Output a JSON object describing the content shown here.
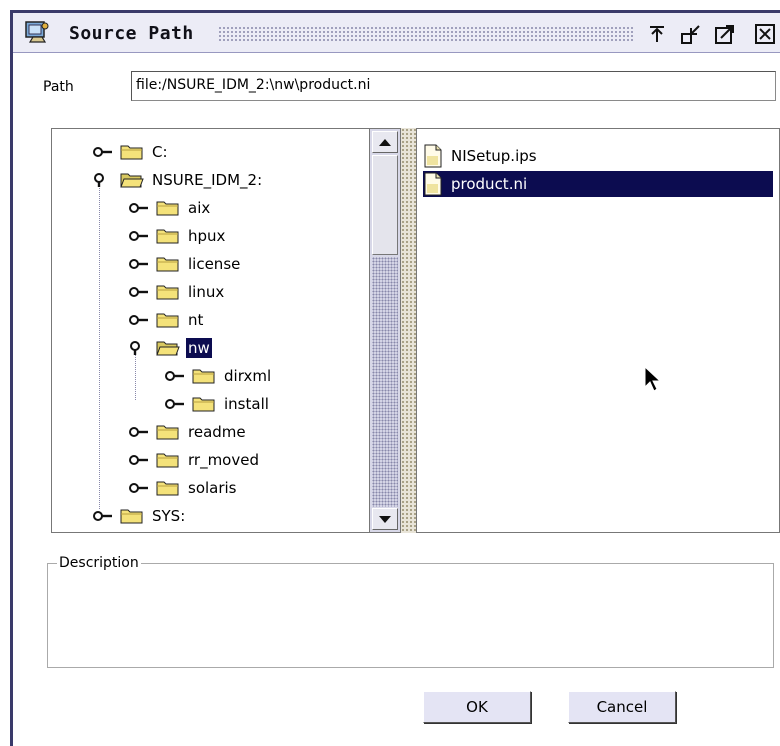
{
  "window": {
    "title": "Source Path"
  },
  "path": {
    "label": "Path",
    "value": "file:/NSURE_IDM_2:\\nw\\product.ni"
  },
  "tree": [
    {
      "label": "C:",
      "depth": 0,
      "expanded": false,
      "open_folder": false,
      "selected": false
    },
    {
      "label": "NSURE_IDM_2:",
      "depth": 0,
      "expanded": true,
      "open_folder": true,
      "selected": false
    },
    {
      "label": "aix",
      "depth": 1,
      "expanded": false,
      "open_folder": false,
      "selected": false
    },
    {
      "label": "hpux",
      "depth": 1,
      "expanded": false,
      "open_folder": false,
      "selected": false
    },
    {
      "label": "license",
      "depth": 1,
      "expanded": false,
      "open_folder": false,
      "selected": false
    },
    {
      "label": "linux",
      "depth": 1,
      "expanded": false,
      "open_folder": false,
      "selected": false
    },
    {
      "label": "nt",
      "depth": 1,
      "expanded": false,
      "open_folder": false,
      "selected": false
    },
    {
      "label": "nw",
      "depth": 1,
      "expanded": true,
      "open_folder": true,
      "selected": true
    },
    {
      "label": "dirxml",
      "depth": 2,
      "expanded": false,
      "open_folder": false,
      "selected": false
    },
    {
      "label": "install",
      "depth": 2,
      "expanded": false,
      "open_folder": false,
      "selected": false
    },
    {
      "label": "readme",
      "depth": 1,
      "expanded": false,
      "open_folder": false,
      "selected": false
    },
    {
      "label": "rr_moved",
      "depth": 1,
      "expanded": false,
      "open_folder": false,
      "selected": false
    },
    {
      "label": "solaris",
      "depth": 1,
      "expanded": false,
      "open_folder": false,
      "selected": false
    },
    {
      "label": "SYS:",
      "depth": 0,
      "expanded": false,
      "open_folder": false,
      "selected": false
    }
  ],
  "files": [
    {
      "name": "NISetup.ips",
      "selected": false
    },
    {
      "name": "product.ni",
      "selected": true
    }
  ],
  "description": {
    "label": "Description",
    "text": ""
  },
  "buttons": {
    "ok": "OK",
    "cancel": "Cancel"
  },
  "colors": {
    "selection": "#0c0c50",
    "folder": "#f4e27a",
    "button_face": "#e4e4f4"
  },
  "icons": {
    "title": "app-window-icon",
    "minimize": "minimize-icon",
    "restore": "restore-icon",
    "maximize": "maximize-icon",
    "close": "close-icon",
    "node_handle": "tree-node-handle-icon",
    "folder": "folder-icon",
    "file": "document-icon"
  }
}
